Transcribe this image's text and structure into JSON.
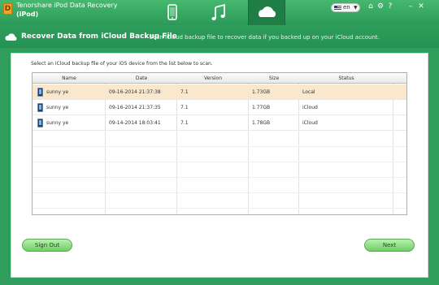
{
  "app": {
    "title": "Tenorshare iPod Data Recovery",
    "subtitle": "(iPod)",
    "logo_letter": "D"
  },
  "mode_tabs": [
    {
      "icon": "phone-icon",
      "active": false
    },
    {
      "icon": "music-note-icon",
      "active": false
    },
    {
      "icon": "cloud-icon",
      "active": true
    }
  ],
  "language": {
    "selected": "en"
  },
  "window_controls": {
    "home": "⌂",
    "settings": "⚙",
    "help": "?",
    "minimize": "–",
    "close": "✕"
  },
  "header": {
    "title": "Recover Data from iCloud Backup File",
    "description": "- Scan iCloud backup file to recover data if you backed up on your iCloud account."
  },
  "instruction": "Select an iCloud backup file of your iOS device from the list below to scan.",
  "table": {
    "columns": [
      "Name",
      "Date",
      "Version",
      "Size",
      "Status"
    ],
    "rows": [
      {
        "name": "sunny ye",
        "date": "09-16-2014 21:37:38",
        "version": "7.1",
        "size": "1.73GB",
        "status": "Local",
        "selected": true
      },
      {
        "name": "sunny ye",
        "date": "09-16-2014 21:37:35",
        "version": "7.1",
        "size": "1.77GB",
        "status": "iCloud",
        "selected": false
      },
      {
        "name": "sunny ye",
        "date": "09-14-2014 18:03:41",
        "version": "7.1",
        "size": "1.78GB",
        "status": "iCloud",
        "selected": false
      }
    ]
  },
  "buttons": {
    "sign_out": "Sign Out",
    "next": "Next"
  },
  "colors": {
    "brand_green": "#2f9e5c",
    "selected_row": "#fbe7cc",
    "button_green": "#6fce65"
  }
}
